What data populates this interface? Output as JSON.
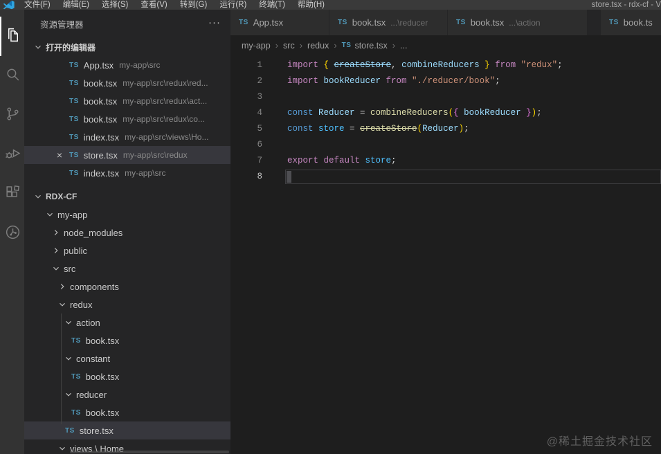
{
  "titlebar": {
    "menus": [
      "文件(F)",
      "编辑(E)",
      "选择(S)",
      "查看(V)",
      "转到(G)",
      "运行(R)",
      "终端(T)",
      "帮助(H)"
    ],
    "title": "store.tsx - rdx-cf - V"
  },
  "activity_bar": {
    "items": [
      {
        "icon": "files",
        "active": true
      },
      {
        "icon": "search",
        "active": false
      },
      {
        "icon": "source-control",
        "active": false
      },
      {
        "icon": "run-debug",
        "active": false
      },
      {
        "icon": "extensions",
        "active": false
      },
      {
        "icon": "remote",
        "active": false
      }
    ]
  },
  "glyphs": {
    "close": "×",
    "more": "···",
    "ts": "TS",
    "crumb_sep": "›"
  },
  "sidebar": {
    "title": "资源管理器",
    "open_editors_label": "打开的编辑器",
    "root_label": "RDX-CF",
    "open_editors": [
      {
        "name": "App.tsx",
        "path": "my-app\\src",
        "selected": false
      },
      {
        "name": "book.tsx",
        "path": "my-app\\src\\redux\\red...",
        "selected": false
      },
      {
        "name": "book.tsx",
        "path": "my-app\\src\\redux\\act...",
        "selected": false
      },
      {
        "name": "book.tsx",
        "path": "my-app\\src\\redux\\co...",
        "selected": false
      },
      {
        "name": "index.tsx",
        "path": "my-app\\src\\views\\Ho...",
        "selected": false
      },
      {
        "name": "store.tsx",
        "path": "my-app\\src\\redux",
        "selected": true
      },
      {
        "name": "index.tsx",
        "path": "my-app\\src",
        "selected": false
      }
    ],
    "tree": [
      {
        "label": "my-app",
        "kind": "folder",
        "open": true,
        "depth": 0,
        "selected": false
      },
      {
        "label": "node_modules",
        "kind": "folder",
        "open": false,
        "depth": 1,
        "selected": false
      },
      {
        "label": "public",
        "kind": "folder",
        "open": false,
        "depth": 1,
        "selected": false
      },
      {
        "label": "src",
        "kind": "folder",
        "open": true,
        "depth": 1,
        "selected": false
      },
      {
        "label": "components",
        "kind": "folder",
        "open": false,
        "depth": 2,
        "selected": false
      },
      {
        "label": "redux",
        "kind": "folder",
        "open": true,
        "depth": 2,
        "selected": false
      },
      {
        "label": "action",
        "kind": "folder",
        "open": true,
        "depth": 3,
        "selected": false
      },
      {
        "label": "book.tsx",
        "kind": "file",
        "open": false,
        "depth": 4,
        "selected": false
      },
      {
        "label": "constant",
        "kind": "folder",
        "open": true,
        "depth": 3,
        "selected": false
      },
      {
        "label": "book.tsx",
        "kind": "file",
        "open": false,
        "depth": 4,
        "selected": false
      },
      {
        "label": "reducer",
        "kind": "folder",
        "open": true,
        "depth": 3,
        "selected": false
      },
      {
        "label": "book.tsx",
        "kind": "file",
        "open": false,
        "depth": 4,
        "selected": false
      },
      {
        "label": "store.tsx",
        "kind": "file",
        "open": false,
        "depth": 3,
        "selected": true
      },
      {
        "label": "views \\ Home",
        "kind": "folder",
        "open": true,
        "depth": 2,
        "selected": false
      }
    ]
  },
  "editor": {
    "tabs": [
      {
        "name": "App.tsx",
        "dim": ""
      },
      {
        "name": "book.tsx",
        "dim": "...\\reducer"
      },
      {
        "name": "book.tsx",
        "dim": "...\\action"
      },
      {
        "name": "book.ts",
        "dim": ""
      }
    ],
    "breadcrumb": {
      "items": [
        "my-app",
        "src",
        "redux"
      ],
      "file": "store.tsx",
      "more": "..."
    },
    "code": {
      "lines": [
        {
          "n": "1",
          "cursor": false,
          "t": [
            [
              "import ",
              "kw"
            ],
            [
              "{ ",
              "b1"
            ],
            [
              "createStore",
              "vr strike"
            ],
            [
              ", ",
              "pn"
            ],
            [
              "combineReducers",
              "vr"
            ],
            [
              " ",
              "pn"
            ],
            [
              "}",
              "b1"
            ],
            [
              " from ",
              "kw"
            ],
            [
              "\"redux\"",
              "st"
            ],
            [
              ";",
              "pn"
            ]
          ]
        },
        {
          "n": "2",
          "cursor": false,
          "t": [
            [
              "import ",
              "kw"
            ],
            [
              "bookReducer",
              "vr"
            ],
            [
              " from ",
              "kw"
            ],
            [
              "\"./reducer/book\"",
              "st"
            ],
            [
              ";",
              "pn"
            ]
          ]
        },
        {
          "n": "3",
          "cursor": false,
          "t": []
        },
        {
          "n": "4",
          "cursor": false,
          "t": [
            [
              "const ",
              "kw2"
            ],
            [
              "Reducer",
              "vr"
            ],
            [
              " = ",
              "pn"
            ],
            [
              "combineReducers",
              "fn"
            ],
            [
              "(",
              "b1"
            ],
            [
              "{",
              "b2"
            ],
            [
              " ",
              "pn"
            ],
            [
              "bookReducer",
              "vr"
            ],
            [
              " ",
              "pn"
            ],
            [
              "}",
              "b2"
            ],
            [
              ")",
              "b1"
            ],
            [
              ";",
              "pn"
            ]
          ]
        },
        {
          "n": "5",
          "cursor": false,
          "t": [
            [
              "const ",
              "kw2"
            ],
            [
              "store",
              "cv"
            ],
            [
              " = ",
              "pn"
            ],
            [
              "createStore",
              "fn strike"
            ],
            [
              "(",
              "b1"
            ],
            [
              "Reducer",
              "vr"
            ],
            [
              ")",
              "b1"
            ],
            [
              ";",
              "pn"
            ]
          ]
        },
        {
          "n": "6",
          "cursor": false,
          "t": []
        },
        {
          "n": "7",
          "cursor": false,
          "t": [
            [
              "export ",
              "kw"
            ],
            [
              "default ",
              "kw"
            ],
            [
              "store",
              "cv"
            ],
            [
              ";",
              "pn"
            ]
          ]
        },
        {
          "n": "8",
          "cursor": true,
          "t": []
        }
      ]
    }
  },
  "watermark": "@稀土掘金技术社区"
}
